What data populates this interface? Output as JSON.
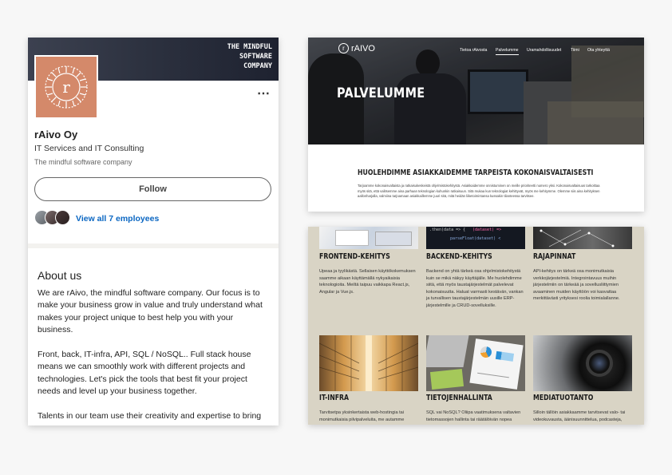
{
  "linkedin": {
    "banner_text": [
      "THE MINDFUL",
      "SOFTWARE",
      "COMPANY"
    ],
    "logo_letter": "r",
    "more_icon": "⋯",
    "company_name": "rAivo Oy",
    "industry": "IT Services and IT Consulting",
    "tagline": "The mindful software company",
    "follow_label": "Follow",
    "employees_link": "View all 7 employees",
    "about_title": "About us",
    "about_paragraphs": [
      "We are rAivo, the mindful software company. Our focus is to make your business grow in value and truly understand what makes your project unique to best help you with your business.",
      "Front, back, IT-infra, API, SQL / NoSQL.. Full stack house means we can smoothly work with different projects and technologies. Let's pick the tools that best fit your project needs and level up your business together.",
      "Talents in our team use their creativity and expertise to bring"
    ],
    "colors": {
      "logo_bg": "#d4896a",
      "link": "#0a66c2"
    }
  },
  "website": {
    "logo": "rAIVO",
    "nav": [
      {
        "label": "Tietoa rAivosta",
        "active": false
      },
      {
        "label": "Palvelumme",
        "active": true
      },
      {
        "label": "Uramahdollisuudet",
        "active": false
      },
      {
        "label": "Tiimi",
        "active": false
      },
      {
        "label": "Ota yhteyttä",
        "active": false
      }
    ],
    "hero_title": "PALVELUMME",
    "section_title": "HUOLEHDIMME ASIAKKAIDEMME TARPEISTA KOKONAISVALTAISESTI",
    "section_body": "Tarjoamme kokonaisvaltaista ja ratkaisukeskeistä ohjelmistokehitystä. Asiakkaidemme onnistuminen on meille prioriteetti numero yksi. Kokonaisvaltaisuus tarkoittaa myös sitä, että valitsemme aina parhaan teknologian kuhunkin ratkaisuun. Sitä mukaa kun teknologiat kehittyvät, myös me kehitymme. Olemme siis aina kehityksen aallonharjalla, valmiina tarjoamaan asiakkaillemme juuri sitä, mitä heidän liiketoimintansa kussakin tilanteessa tarvitsee.",
    "services": [
      {
        "title": "FRONTEND-KEHITYS",
        "body": "Upeaa ja tyylikästä. Sellaisen käyttökokemuksen saamme aikaan käyttämällä nykyaikaisia teknologioita. Meiltä taipuu vaikkapa React.js, Angular ja Vue.js."
      },
      {
        "title": "BACKEND-KEHITYS",
        "body": "Backend on yhtä tärkeä osa ohjelmistokehitystä kuin se mikä näkyy käyttäjälle. Me huolehdimme siitä, että myös taustajärjestelmät palvelevat kokonaisuutta. Haluat varmasti kestävän, vankan ja turvallisen taustajärjestelmän uusille ERP-järjestelmille ja CRUD-sovelluksille."
      },
      {
        "title": "RAJAPINNAT",
        "body": "API-kehitys on tärkeä osa monimutkaisia verkkojärjestelmiä. Integrointavuus muihin järjestelmiin on tärkeää ja sovellusliittymien avaaminen muiden käyttöön voi kasvattaa merkittävästi yrityksesi roolia toimialallanne."
      },
      {
        "title": "IT-INFRA",
        "body": "Tarvitsetpa yksinkertaista web-hostingia tai monimutkaisia pilvipalveluita, me autamme"
      },
      {
        "title": "TIETOJENHALLINTA",
        "body": "SQL vai NoSQL? Oliipa vaatimuksena valtavien tietomassojen hallinta tai räätälöivän nopea"
      },
      {
        "title": "MEDIATUOTANTO",
        "body": "Silloin tällöin asiakkaamme tarvitsevat valo- tai videokuvausta, äänisuunnittelua, podcasteja,"
      }
    ],
    "code_snippet": [
      ".then(data => {",
      "(dataset) =>",
      "parseFloat(dataset) <"
    ]
  }
}
